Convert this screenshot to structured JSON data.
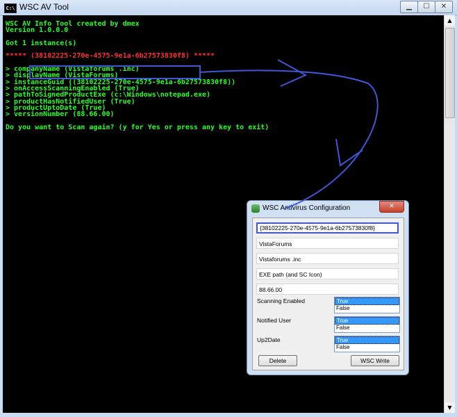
{
  "console": {
    "title": "WSC AV Tool",
    "icon_label": "C:\\",
    "lines": [
      {
        "text": "WSC AV Info Tool created by dmex",
        "color": "green"
      },
      {
        "text": "Version 1.0.0.0",
        "color": "green"
      },
      {
        "text": "",
        "color": "green"
      },
      {
        "text": "Got 1 instance(s)",
        "color": "green"
      },
      {
        "text": "",
        "color": "green"
      },
      {
        "text": "***** (38102225-270e-4575-9e1a-6b27573830f8) *****",
        "color": "red"
      },
      {
        "text": "",
        "color": "green"
      },
      {
        "text": "> companyName (Vistaforums .inc)",
        "color": "green"
      },
      {
        "text": "> displayName (VistaForums)",
        "color": "green"
      },
      {
        "text": "> instanceGuid ((38102225-270e-4575-9e1a-6b27573830f8))",
        "color": "green"
      },
      {
        "text": "> onAccessScanningEnabled (True)",
        "color": "green"
      },
      {
        "text": "> pathToSignedProductExe (c:\\Windows\\notepad.exe)",
        "color": "green"
      },
      {
        "text": "> productHasNotifiedUser (True)",
        "color": "green"
      },
      {
        "text": "> productUptoDate (True)",
        "color": "green"
      },
      {
        "text": "> versionNumber (88.66.00)",
        "color": "green"
      },
      {
        "text": "",
        "color": "green"
      },
      {
        "text": "Do you want to Scan again? (y for Yes or press any key to exit)",
        "color": "green"
      }
    ],
    "window_buttons": {
      "minimize": "▁",
      "maximize": "☐",
      "close": "✕"
    },
    "scroll": {
      "up": "▲",
      "down": "▼"
    }
  },
  "dialog": {
    "title": "WSC Antivirus Configuration",
    "close_label": "✕",
    "fields": {
      "guid": "{38102225-270e-4575-9e1a-6b27573830f8}",
      "display_name": "VistaForums",
      "company": "Vistaforums .inc",
      "exe_path": "EXE path (and SC Icon)",
      "version": "88.66.00"
    },
    "scanning": {
      "label": "Scanning Enabled",
      "options": [
        "True",
        "False"
      ],
      "selected": "True"
    },
    "notified": {
      "label": "Notified User",
      "options": [
        "True",
        "False"
      ],
      "selected": "True"
    },
    "uptodate": {
      "label": "Up2Date",
      "options": [
        "True",
        "False"
      ],
      "selected": "True"
    },
    "buttons": {
      "delete": "Delete",
      "write": "WSC Write"
    }
  },
  "colors": {
    "console_bg": "#000000",
    "console_text": "#29ff29",
    "console_highlight_text": "#ff3030",
    "annotation": "#3f57d8",
    "list_selection": "#3399ff"
  }
}
